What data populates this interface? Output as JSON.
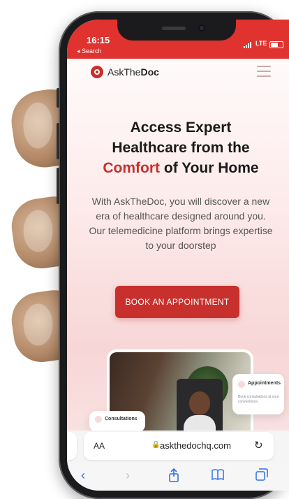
{
  "status_bar": {
    "time": "16:15",
    "back_label": "◂ Search",
    "network": "LTE"
  },
  "site": {
    "brand_prefix": "AskThe",
    "brand_bold": "Doc",
    "hero": {
      "title_line1": "Access Expert",
      "title_line2": "Healthcare from the",
      "title_accent": "Comfort",
      "title_rest": " of Your Home",
      "description": "With AskTheDoc, you will discover a new era of healthcare designed around you. Our telemedicine platform brings expertise to your doorstep",
      "cta_label": "BOOK AN APPOINTMENT"
    },
    "cards": {
      "appointments_title": "Appointments",
      "appointments_sub": "Book consultations at your convenience.",
      "consultations_title": "Consultations"
    }
  },
  "browser": {
    "aa_label": "AA",
    "url": "askthedochq.com",
    "icons": [
      "back-icon",
      "forward-icon",
      "share-icon",
      "bookmarks-icon",
      "tabs-icon",
      "reload-icon",
      "lock-icon"
    ]
  },
  "colors": {
    "brand_red": "#c7302c",
    "status_red": "#e0322e",
    "safari_blue": "#2f6fea"
  }
}
